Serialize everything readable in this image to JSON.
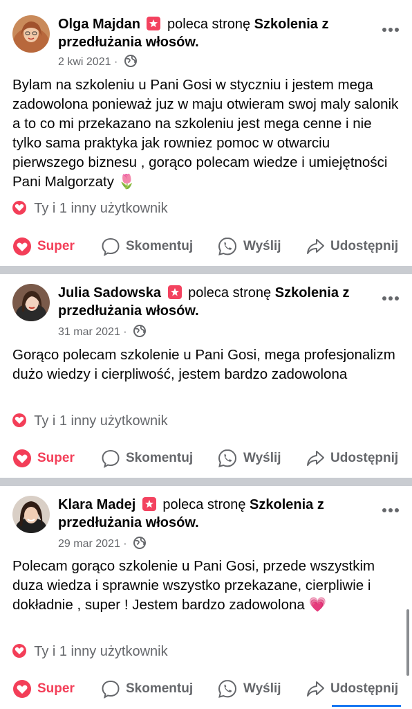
{
  "posts": [
    {
      "author": "Olga Majdan",
      "verb": "poleca stronę",
      "page": "Szkolenia z przedłużania włosów.",
      "date": "2 kwi 2021 ·",
      "text": "Bylam na szkoleniu u Pani Gosi w styczniu i jestem mega zadowolona ponieważ juz w maju otwieram swoj maly salonik a to co mi przekazano na szkoleniu jest mega cenne i nie tylko sama praktyka jak rowniez pomoc w otwarciu pierwszego biznesu , gorąco polecam wiedze i umiejętności Pani Malgorzaty",
      "emoji": "🌷",
      "reactions": "Ty i 1 inny użytkownik"
    },
    {
      "author": "Julia Sadowska",
      "verb": "poleca stronę",
      "page": "Szkolenia z przedłużania włosów.",
      "date": "31 mar 2021 ·",
      "text": "Gorąco polecam szkolenie u Pani Gosi, mega profesjonalizm dużo wiedzy i cierpliwość, jestem bardzo zadowolona",
      "emoji": "",
      "reactions": "Ty i 1 inny użytkownik"
    },
    {
      "author": "Klara Madej",
      "verb": "poleca stronę",
      "page": "Szkolenia z przedłużania włosów.",
      "date": "29 mar 2021 ·",
      "text": "Polecam gorąco szkolenie u Pani Gosi, przede wszystkim duza wiedza i sprawnie wszystko przekazane, cierpliwie i dokładnie , super ! Jestem bardzo zadowolona",
      "emoji": "💗",
      "reactions": "Ty i 1 inny użytkownik"
    }
  ],
  "actions": {
    "super": "Super",
    "comment": "Skomentuj",
    "send": "Wyślij",
    "share": "Udostępnij"
  },
  "icons": {
    "recommend": "recommend-star-icon",
    "privacy": "globe-icon",
    "more": "more-options-icon",
    "reaction": "heart-icon",
    "comment": "comment-bubble-icon",
    "send": "whatsapp-icon",
    "share": "share-arrow-icon"
  },
  "colors": {
    "super": "#f33e58",
    "recommend_badge": "#f3425f",
    "secondary_text": "#65676b",
    "divider": "#c9ccd1"
  }
}
